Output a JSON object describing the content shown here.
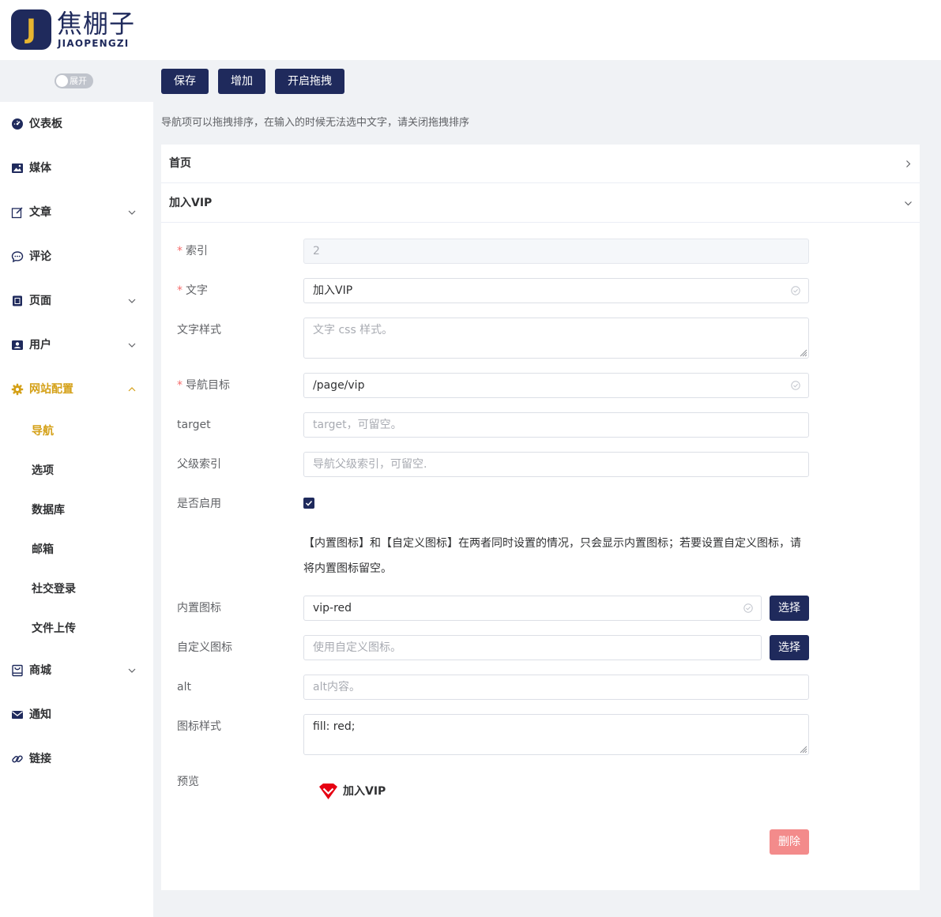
{
  "brand": {
    "logo_letter": "J",
    "name_cn": "焦棚子",
    "name_en": "JIAOPENGZI"
  },
  "sidebar": {
    "toggle_label": "展开",
    "items": [
      {
        "label": "仪表板",
        "icon": "dashboard-icon"
      },
      {
        "label": "媒体",
        "icon": "image-icon"
      },
      {
        "label": "文章",
        "icon": "edit-icon"
      },
      {
        "label": "评论",
        "icon": "comment-icon"
      },
      {
        "label": "页面",
        "icon": "page-icon"
      },
      {
        "label": "用户",
        "icon": "user-icon"
      },
      {
        "label": "网站配置",
        "icon": "gear-icon"
      },
      {
        "label": "商城",
        "icon": "shop-icon"
      },
      {
        "label": "通知",
        "icon": "mail-icon"
      },
      {
        "label": "链接",
        "icon": "link-icon"
      }
    ],
    "sub_items": [
      {
        "label": "导航"
      },
      {
        "label": "选项"
      },
      {
        "label": "数据库"
      },
      {
        "label": "邮箱"
      },
      {
        "label": "社交登录"
      },
      {
        "label": "文件上传"
      }
    ]
  },
  "toolbar": {
    "save": "保存",
    "add": "增加",
    "drag": "开启拖拽"
  },
  "hint": "导航项可以拖拽排序，在输入的时候无法选中文字，请关闭拖拽排序",
  "collapse": [
    {
      "title": "首页",
      "expanded": false
    },
    {
      "title": "加入VIP",
      "expanded": true
    }
  ],
  "form": {
    "index": {
      "label": "索引",
      "value": "2"
    },
    "text": {
      "label": "文字",
      "value": "加入VIP"
    },
    "text_style": {
      "label": "文字样式",
      "placeholder": "文字 css 样式。"
    },
    "nav_target": {
      "label": "导航目标",
      "value": "/page/vip"
    },
    "target": {
      "label": "target",
      "placeholder": "target，可留空。"
    },
    "parent_index": {
      "label": "父级索引",
      "placeholder": "导航父级索引，可留空."
    },
    "enabled": {
      "label": "是否启用",
      "checked": true
    },
    "note": "【内置图标】和【自定义图标】在两者同时设置的情况，只会显示内置图标；若要设置自定义图标，请将内置图标留空。",
    "builtin_icon": {
      "label": "内置图标",
      "value": "vip-red",
      "button": "选择"
    },
    "custom_icon": {
      "label": "自定义图标",
      "placeholder": "使用自定义图标。",
      "button": "选择"
    },
    "alt": {
      "label": "alt",
      "placeholder": "alt内容。"
    },
    "icon_style": {
      "label": "图标样式",
      "value": "fill: red;"
    },
    "preview": {
      "label": "预览",
      "text": "加入VIP"
    },
    "delete_button": "删除",
    "required_mark": "*"
  },
  "colors": {
    "primary": "#1f2a5c",
    "accent": "#d4a017",
    "danger": "#f38b8b",
    "required": "#f56c6c"
  }
}
